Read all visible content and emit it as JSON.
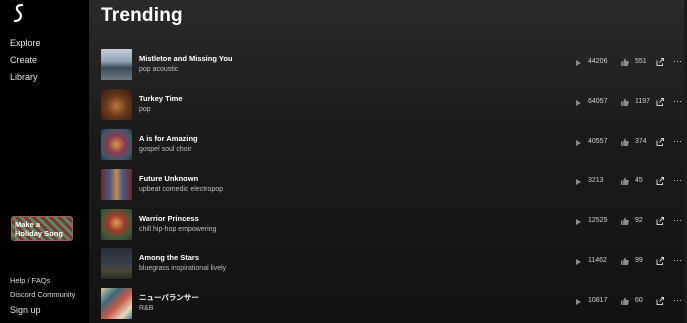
{
  "sidebar": {
    "nav": [
      {
        "label": "Explore"
      },
      {
        "label": "Create"
      },
      {
        "label": "Library"
      }
    ],
    "holiday_button": "Make a Holiday Song",
    "footer": [
      {
        "label": "Help / FAQs"
      },
      {
        "label": "Discord Community"
      },
      {
        "label": "Sign up"
      }
    ]
  },
  "main": {
    "title": "Trending",
    "songs": [
      {
        "title": "Mistletoe and Missing You",
        "tags": "pop acoustic",
        "plays": "44206",
        "likes": "551"
      },
      {
        "title": "Turkey Time",
        "tags": "pop",
        "plays": "64057",
        "likes": "1197"
      },
      {
        "title": "A is for Amazing",
        "tags": "gospel soul choir",
        "plays": "40557",
        "likes": "374"
      },
      {
        "title": "Future Unknown",
        "tags": "upbeat comedic electropop",
        "plays": "3213",
        "likes": "45"
      },
      {
        "title": "Warrior Princess",
        "tags": "chill hip-hop empowering",
        "plays": "12525",
        "likes": "92"
      },
      {
        "title": "Among the Stars",
        "tags": "bluegrass inspirational lively",
        "plays": "11462",
        "likes": "99"
      },
      {
        "title": "ニューバランサー",
        "tags": "R&B",
        "plays": "10817",
        "likes": "60"
      }
    ]
  },
  "icons": {
    "logo": "suno-wave-logo",
    "play": "play-icon",
    "like": "thumbs-up-icon",
    "share": "share-icon",
    "more": "more-dots-icon"
  }
}
